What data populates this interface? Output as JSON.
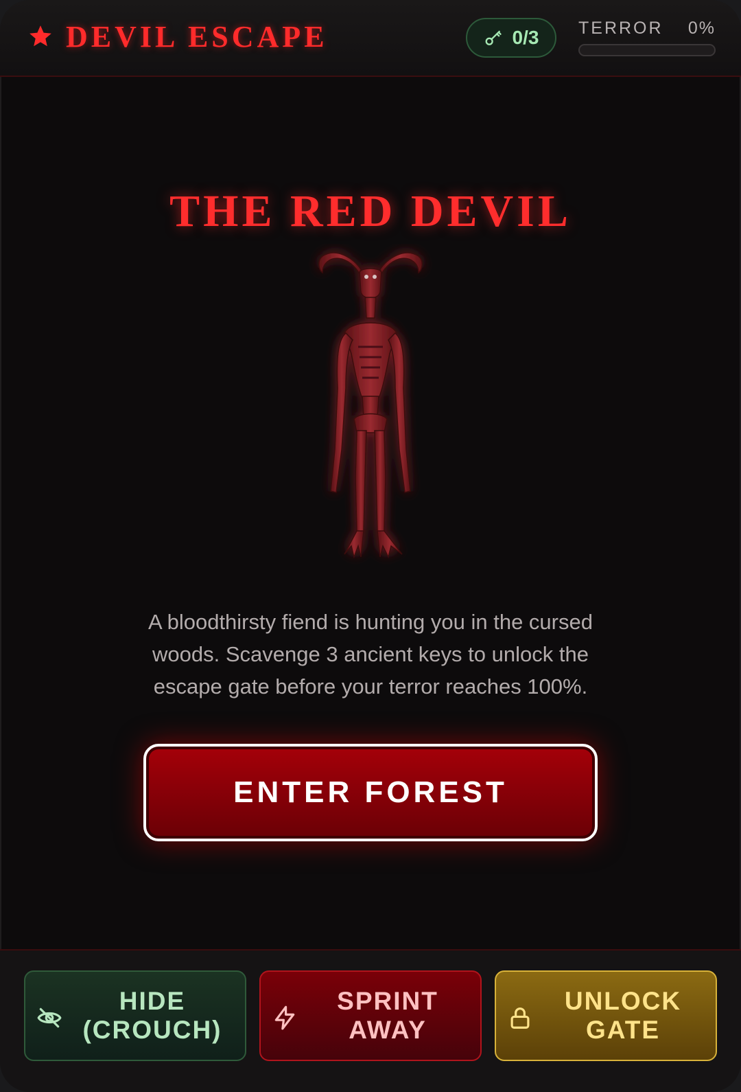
{
  "header": {
    "brand_icon": "star-icon",
    "title": "DEVIL ESCAPE",
    "keys": {
      "icon": "key-icon",
      "label": "0/3",
      "collected": 0,
      "total": 3
    },
    "terror": {
      "label": "TERROR",
      "value_label": "0%",
      "value_percent": 0
    }
  },
  "main": {
    "villain_title": "THE RED DEVIL",
    "villain_image": "red-devil-creature",
    "description": "A bloodthirsty fiend is hunting you in the cursed woods. Scavenge 3 ancient keys to unlock the escape gate before your terror reaches 100%.",
    "start_button": "ENTER FOREST"
  },
  "actions": [
    {
      "icon": "eye-off-icon",
      "label": "HIDE (CROUCH)"
    },
    {
      "icon": "lightning-icon",
      "label": "SPRINT AWAY"
    },
    {
      "icon": "lock-icon",
      "label": "UNLOCK GATE"
    }
  ],
  "colors": {
    "accent_red": "#ff2b2b",
    "background": "#0d0b0c",
    "hide_green": "#b7e6bf",
    "sprint_red": "#ffc1c1",
    "unlock_gold": "#ffe38a"
  }
}
